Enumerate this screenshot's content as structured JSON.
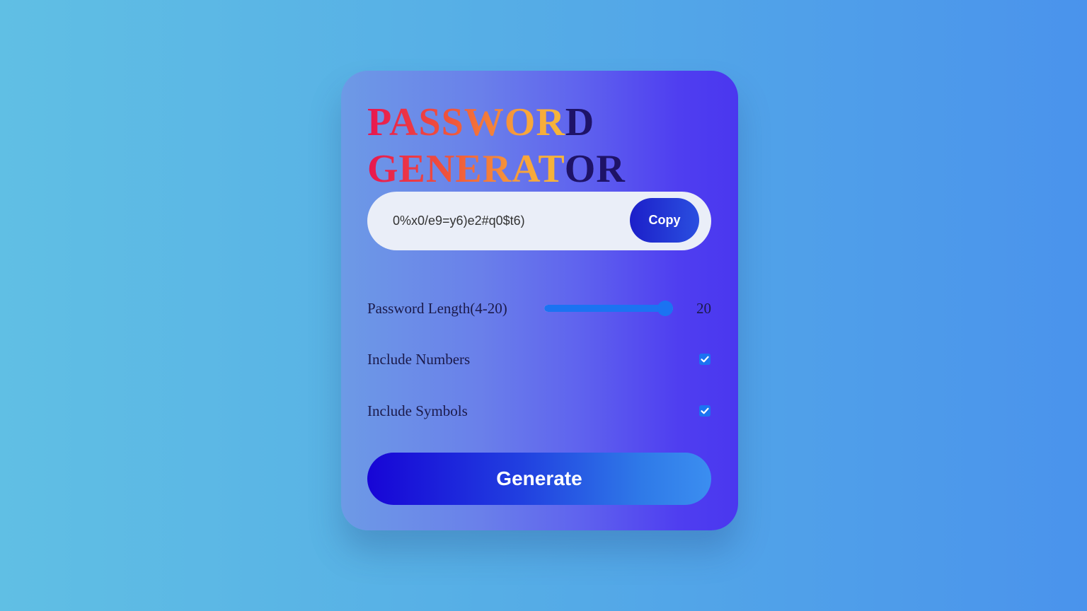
{
  "title": {
    "line1_gradient": "PASSWOR",
    "line1_rest": "D",
    "line2_gradient": "GENERAT",
    "line2_rest": "OR"
  },
  "password": {
    "value": "0%x0/e9=y6)e2#q0$t6)",
    "copy_label": "Copy"
  },
  "options": {
    "length_label": "Password Length(4-20)",
    "length_min": 4,
    "length_max": 20,
    "length_value": "20",
    "numbers_label": "Include Numbers",
    "numbers_checked": true,
    "symbols_label": "Include Symbols",
    "symbols_checked": true
  },
  "generate_label": "Generate",
  "colors": {
    "accent": "#1b73f2",
    "title_dark": "#1e1367",
    "button_start": "#1705d6",
    "button_end": "#3b8ef0"
  },
  "icons": {
    "checkbox": "check-icon"
  }
}
